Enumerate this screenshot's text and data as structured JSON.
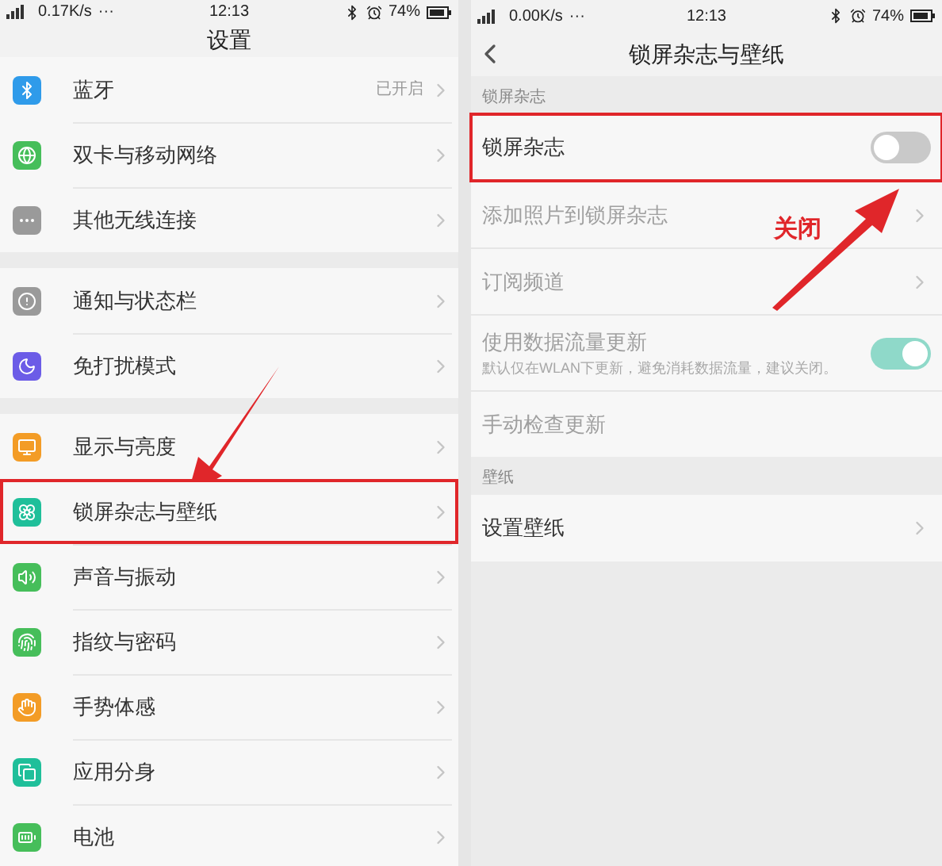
{
  "left_screen": {
    "status_bar": {
      "network_speed": "0.17K/s",
      "more": "···",
      "time": "12:13",
      "battery": "74%"
    },
    "title": "设置",
    "groups": [
      {
        "items": [
          {
            "label": "蓝牙",
            "color": "#2f9bea",
            "value": "已开启",
            "annotated": false
          },
          {
            "label": "双卡与移动网络",
            "color": "#46be5a",
            "annotated": false
          },
          {
            "label": "其他无线连接",
            "color": "#9a9a9a",
            "annotated": false
          }
        ]
      },
      {
        "items": [
          {
            "label": "通知与状态栏",
            "color": "#9a9a9a",
            "annotated": false
          },
          {
            "label": "免打扰模式",
            "color": "#6c5ce7",
            "annotated": false
          }
        ]
      },
      {
        "items": [
          {
            "label": "显示与亮度",
            "color": "#f39c26",
            "annotated": false
          },
          {
            "label": "锁屏杂志与壁纸",
            "color": "#1fbf9a",
            "annotated": true
          },
          {
            "label": "声音与振动",
            "color": "#46be5a",
            "annotated": false
          },
          {
            "label": "指纹与密码",
            "color": "#46be5a",
            "annotated": false
          },
          {
            "label": "手势体感",
            "color": "#f39c26",
            "annotated": false
          },
          {
            "label": "应用分身",
            "color": "#1fbf9a",
            "annotated": false
          },
          {
            "label": "电池",
            "color": "#46be5a",
            "annotated": false
          }
        ]
      }
    ]
  },
  "right_screen": {
    "status_bar": {
      "network_speed": "0.00K/s",
      "more": "···",
      "time": "12:13",
      "battery": "74%"
    },
    "title": "锁屏杂志与壁纸",
    "sections": [
      {
        "header": "锁屏杂志",
        "items": [
          {
            "kind": "switch",
            "label": "锁屏杂志",
            "on": false,
            "disabled": false,
            "annotated": true
          },
          {
            "kind": "link",
            "label": "添加照片到锁屏杂志",
            "disabled": true,
            "annotated": false
          },
          {
            "kind": "link",
            "label": "订阅频道",
            "disabled": true,
            "annotated": false
          },
          {
            "kind": "switch",
            "label": "使用数据流量更新",
            "subtitle": "默认仅在WLAN下更新，避免消耗数据流量，建议关闭。",
            "on": true,
            "disabled": true,
            "annotated": false
          },
          {
            "kind": "plain",
            "label": "手动检查更新",
            "disabled": true,
            "annotated": false
          }
        ]
      },
      {
        "header": "壁纸",
        "items": [
          {
            "kind": "link",
            "label": "设置壁纸",
            "disabled": false,
            "annotated": false
          }
        ]
      }
    ]
  },
  "annotation": {
    "callout": "关闭"
  }
}
